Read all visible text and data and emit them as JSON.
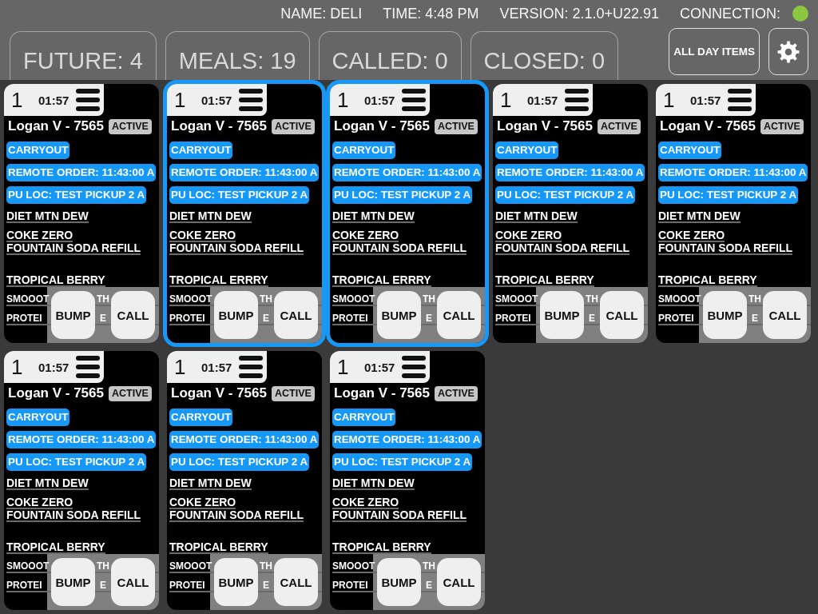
{
  "status_bar": {
    "name": "NAME: DELI",
    "time": "TIME: 4:48 PM",
    "version": "VERSION: 2.1.0+U22.91",
    "connection": {
      "label": "CONNECTION:",
      "connected": true
    }
  },
  "tabs": [
    {
      "label": "FUTURE: 4"
    },
    {
      "label": "MEALS: 19"
    },
    {
      "label": "CALLED: 0"
    },
    {
      "label": "CLOSED: 0"
    }
  ],
  "toolbar": {
    "all_day_items": "ALL DAY ITEMS"
  },
  "cards": [
    {
      "selected": false,
      "number": "1",
      "timer": "01:57",
      "customer": "Logan V - 7565",
      "status": "ACTIVE",
      "tags": [
        "CARRYOUT",
        "REMOTE ORDER: 11:43:00 A",
        "PU LOC: TEST PICKUP 2 A"
      ],
      "items": [
        {
          "kind": "plain",
          "lines": [
            "DIET MTN DEW"
          ]
        },
        {
          "kind": "plain",
          "lines": [
            "COKE ZERO",
            "FOUNTAIN SODA REFILL"
          ]
        },
        {
          "kind": "plain",
          "lines": [
            "TROPICAL BERRY"
          ]
        },
        {
          "kind": "covered",
          "parts": [
            "SMOOOT",
            "TH"
          ]
        },
        {
          "kind": "covered",
          "parts": [
            "PROTEI",
            "E"
          ]
        }
      ],
      "buttons": [
        "BUMP",
        "CALL"
      ]
    },
    {
      "selected": true,
      "number": "1",
      "timer": "01:57",
      "customer": "Logan V - 7565",
      "status": "ACTIVE",
      "tags": [
        "CARRYOUT",
        "REMOTE ORDER: 11:43:00 A",
        "PU LOC: TEST PICKUP 2 A"
      ],
      "items": [
        {
          "kind": "plain",
          "lines": [
            "DIET MTN DEW"
          ]
        },
        {
          "kind": "plain",
          "lines": [
            "COKE ZERO",
            "FOUNTAIN SODA REFILL"
          ]
        },
        {
          "kind": "plain",
          "lines": [
            "TROPICAL ERRRY"
          ]
        },
        {
          "kind": "covered",
          "parts": [
            "SMOOOT",
            "TH"
          ]
        },
        {
          "kind": "covered",
          "parts": [
            "PROTEI",
            "E"
          ]
        }
      ],
      "buttons": [
        "BUMP",
        "CALL"
      ]
    },
    {
      "selected": true,
      "number": "1",
      "timer": "01:57",
      "customer": "Logan V - 7565",
      "status": "ACTIVE",
      "tags": [
        "CARRYOUT",
        "REMOTE ORDER: 11:43:00 A",
        "PU LOC: TEST PICKUP 2 A"
      ],
      "items": [
        {
          "kind": "plain",
          "lines": [
            "DIET MTN DEW"
          ]
        },
        {
          "kind": "plain",
          "lines": [
            "COKE ZERO",
            "FOUNTAIN SODA REFILL"
          ]
        },
        {
          "kind": "plain",
          "lines": [
            "TROPICAL ERRRY"
          ]
        },
        {
          "kind": "covered",
          "parts": [
            "SMOOOT",
            "TH"
          ]
        },
        {
          "kind": "covered",
          "parts": [
            "PROTEI",
            "E"
          ]
        }
      ],
      "buttons": [
        "BUMP",
        "CALL"
      ]
    },
    {
      "selected": false,
      "number": "1",
      "timer": "01:57",
      "customer": "Logan V - 7565",
      "status": "ACTIVE",
      "tags": [
        "CARRYOUT",
        "REMOTE ORDER: 11:43:00 A",
        "PU LOC: TEST PICKUP 2 A"
      ],
      "items": [
        {
          "kind": "plain",
          "lines": [
            "DIET MTN DEW"
          ]
        },
        {
          "kind": "plain",
          "lines": [
            "COKE ZERO",
            "FOUNTAIN SODA REFILL"
          ]
        },
        {
          "kind": "plain",
          "lines": [
            "TROPICAL BERRY"
          ]
        },
        {
          "kind": "covered",
          "parts": [
            "SMOOOT",
            "TH"
          ]
        },
        {
          "kind": "covered",
          "parts": [
            "PROTEI",
            "E"
          ]
        }
      ],
      "buttons": [
        "BUMP",
        "CALL"
      ]
    },
    {
      "selected": false,
      "number": "1",
      "timer": "01:57",
      "customer": "Logan V - 7565",
      "status": "ACTIVE",
      "tags": [
        "CARRYOUT",
        "REMOTE ORDER: 11:43:00 A",
        "PU LOC: TEST PICKUP 2 A"
      ],
      "items": [
        {
          "kind": "plain",
          "lines": [
            "DIET MTN DEW"
          ]
        },
        {
          "kind": "plain",
          "lines": [
            "COKE ZERO",
            "FOUNTAIN SODA REFILL"
          ]
        },
        {
          "kind": "plain",
          "lines": [
            "TROPICAL BERRY"
          ]
        },
        {
          "kind": "covered",
          "parts": [
            "SMOOOT",
            "TH"
          ]
        },
        {
          "kind": "covered",
          "parts": [
            "PROTEI",
            "E"
          ]
        }
      ],
      "buttons": [
        "BUMP",
        "CALL"
      ]
    },
    {
      "selected": false,
      "number": "1",
      "timer": "01:57",
      "customer": "Logan V - 7565",
      "status": "ACTIVE",
      "tags": [
        "CARRYOUT",
        "REMOTE ORDER: 11:43:00 A",
        "PU LOC: TEST PICKUP 2 A"
      ],
      "items": [
        {
          "kind": "plain",
          "lines": [
            "DIET MTN DEW"
          ]
        },
        {
          "kind": "plain",
          "lines": [
            "COKE ZERO",
            "FOUNTAIN SODA REFILL"
          ]
        },
        {
          "kind": "plain",
          "lines": [
            "TROPICAL BERRY"
          ]
        },
        {
          "kind": "covered",
          "parts": [
            "SMOOOT",
            "TH"
          ]
        },
        {
          "kind": "covered",
          "parts": [
            "PROTEI",
            "E"
          ]
        }
      ],
      "buttons": [
        "BUMP",
        "CALL"
      ]
    },
    {
      "selected": false,
      "number": "1",
      "timer": "01:57",
      "customer": "Logan V - 7565",
      "status": "ACTIVE",
      "tags": [
        "CARRYOUT",
        "REMOTE ORDER: 11:43:00 A",
        "PU LOC: TEST PICKUP 2 A"
      ],
      "items": [
        {
          "kind": "plain",
          "lines": [
            "DIET MTN DEW"
          ]
        },
        {
          "kind": "plain",
          "lines": [
            "COKE ZERO",
            "FOUNTAIN SODA REFILL"
          ]
        },
        {
          "kind": "plain",
          "lines": [
            "TROPICAL BERRY"
          ]
        },
        {
          "kind": "covered",
          "parts": [
            "SMOOOT",
            "TH"
          ]
        },
        {
          "kind": "covered",
          "parts": [
            "PROTEI",
            "E"
          ]
        }
      ],
      "buttons": [
        "BUMP",
        "CALL"
      ]
    },
    {
      "selected": false,
      "number": "1",
      "timer": "01:57",
      "customer": "Logan V - 7565",
      "status": "ACTIVE",
      "tags": [
        "CARRYOUT",
        "REMOTE ORDER: 11:43:00 A",
        "PU LOC: TEST PICKUP 2 A"
      ],
      "items": [
        {
          "kind": "plain",
          "lines": [
            "DIET MTN DEW"
          ]
        },
        {
          "kind": "plain",
          "lines": [
            "COKE ZERO",
            "FOUNTAIN SODA REFILL"
          ]
        },
        {
          "kind": "plain",
          "lines": [
            "TROPICAL BERRY"
          ]
        },
        {
          "kind": "covered",
          "parts": [
            "SMOOOT",
            "TH"
          ]
        },
        {
          "kind": "covered",
          "parts": [
            "PROTEI",
            "E"
          ]
        }
      ],
      "buttons": [
        "BUMP",
        "CALL"
      ]
    }
  ]
}
